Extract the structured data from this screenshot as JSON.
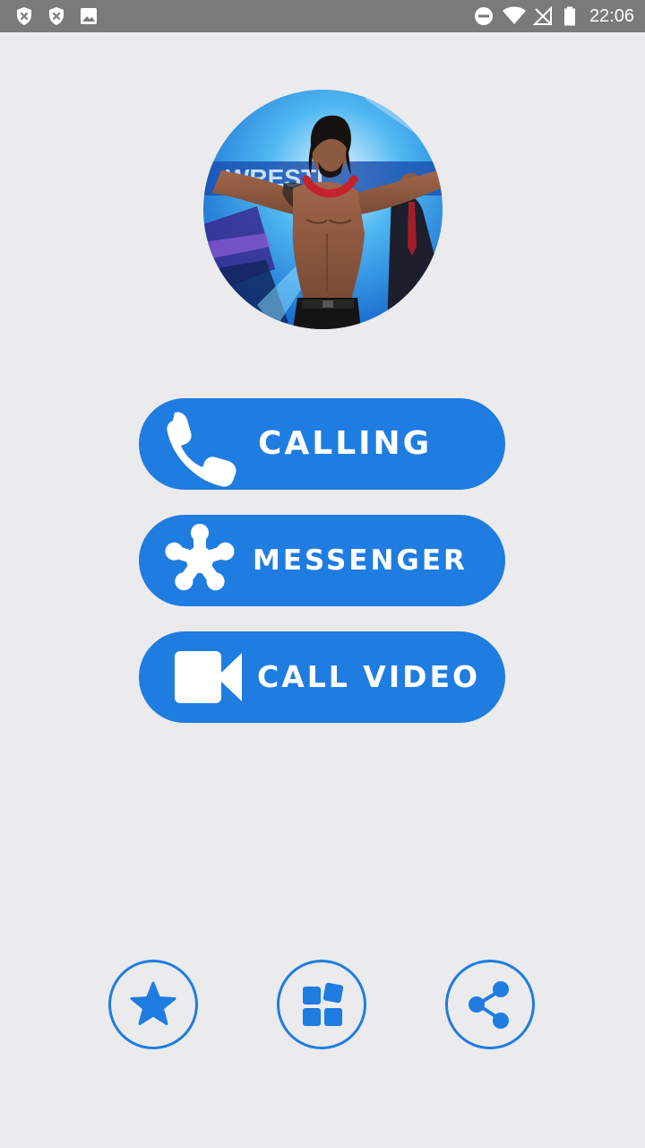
{
  "status_bar": {
    "time": "22:06",
    "left_icons": [
      "shield-x-icon",
      "shield-x-icon",
      "image-icon"
    ],
    "right_icons": [
      "do-not-disturb-icon",
      "wifi-icon",
      "no-signal-icon",
      "battery-icon"
    ]
  },
  "avatar": {
    "description_icon": "wrestler-photo"
  },
  "actions": {
    "calling_label": "CALLING",
    "calling_icon": "phone-icon",
    "messenger_label": "MESSENGER",
    "messenger_icon": "messenger-asterisk-icon",
    "video_label": "CALL VIDEO",
    "video_icon": "video-camera-icon"
  },
  "bottom_bar": {
    "rate_icon": "star-icon",
    "more_apps_icon": "grid-icon",
    "share_icon": "share-icon"
  },
  "colors": {
    "accent": "#1f7ce0",
    "background": "#ebebed",
    "status_bar": "#7a7a7a"
  }
}
